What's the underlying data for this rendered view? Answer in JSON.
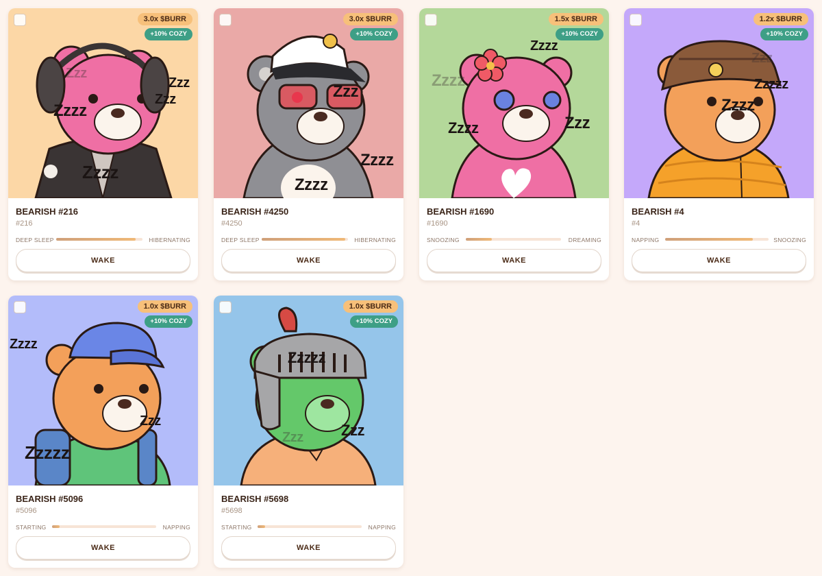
{
  "cards": [
    {
      "name": "BEARISH #216",
      "id": "#216",
      "multiplier": "3.0x $BURR",
      "cozy": "+10% COZY",
      "stage_from": "DEEP SLEEP",
      "stage_to": "HIBERNATING",
      "progress": 0.92,
      "wake_label": "WAKE",
      "bg": "#fcd7a6",
      "fur": "#ef6fa4",
      "accessory": "headphones",
      "zzz": [
        "Zzz",
        "Zzz",
        "Zzzz",
        "Zzz",
        "Zzzz"
      ]
    },
    {
      "name": "BEARISH #4250",
      "id": "#4250",
      "multiplier": "3.0x $BURR",
      "cozy": "+10% COZY",
      "stage_from": "DEEP SLEEP",
      "stage_to": "HIBERNATING",
      "progress": 0.97,
      "wake_label": "WAKE",
      "bg": "#eaa9a7",
      "fur": "#8f8f94",
      "accessory": "captain-hat",
      "zzz": [
        "Zzz",
        "Zzzz",
        "Zzzz"
      ]
    },
    {
      "name": "BEARISH #1690",
      "id": "#1690",
      "multiplier": "1.5x $BURR",
      "cozy": "+10% COZY",
      "stage_from": "SNOOZING",
      "stage_to": "DREAMING",
      "progress": 0.27,
      "wake_label": "WAKE",
      "bg": "#b4d89a",
      "fur": "#ef6fa4",
      "accessory": "flower",
      "zzz": [
        "Zzzz",
        "Zzzz",
        "Zzzz",
        "Zzz"
      ]
    },
    {
      "name": "BEARISH #4",
      "id": "#4",
      "multiplier": "1.2x $BURR",
      "cozy": "+10% COZY",
      "stage_from": "NAPPING",
      "stage_to": "SNOOZING",
      "progress": 0.85,
      "wake_label": "WAKE",
      "bg": "#c4a8fa",
      "fur": "#f3a05a",
      "accessory": "bucket-hat",
      "zzz": [
        "Zzz",
        "Zzzz",
        "Zzzzz"
      ]
    },
    {
      "name": "BEARISH #5096",
      "id": "#5096",
      "multiplier": "1.0x $BURR",
      "cozy": "+10% COZY",
      "stage_from": "STARTING",
      "stage_to": "NAPPING",
      "progress": 0.07,
      "wake_label": "WAKE",
      "bg": "#b3bcfa",
      "fur": "#f3a05a",
      "accessory": "cap",
      "zzz": [
        "Zzzz",
        "Zzz",
        "Zzzzz"
      ]
    },
    {
      "name": "BEARISH #5698",
      "id": "#5698",
      "multiplier": "1.0x $BURR",
      "cozy": "+10% COZY",
      "stage_from": "STARTING",
      "stage_to": "NAPPING",
      "progress": 0.07,
      "wake_label": "WAKE",
      "bg": "#95c5ea",
      "fur": "#64c86a",
      "accessory": "knight-helmet",
      "zzz": [
        "Zzzzz",
        "Zzz",
        "Zzz"
      ]
    }
  ]
}
